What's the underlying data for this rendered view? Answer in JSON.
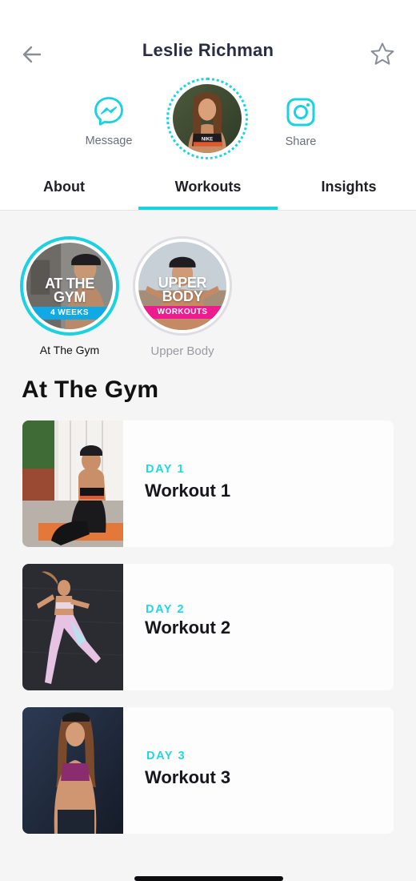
{
  "header": {
    "title": "Leslie Richman"
  },
  "actions": {
    "message_label": "Message",
    "share_label": "Share"
  },
  "tabs": [
    {
      "label": "About"
    },
    {
      "label": "Workouts"
    },
    {
      "label": "Insights"
    }
  ],
  "programs": [
    {
      "title_line1": "AT THE",
      "title_line2": "GYM",
      "badge": "4 WEEKS",
      "label": "At The Gym"
    },
    {
      "title_line1": "UPPER",
      "title_line2": "BODY",
      "badge": "WORKOUTS",
      "label": "Upper Body"
    }
  ],
  "section": {
    "title": "At The Gym"
  },
  "workouts": [
    {
      "day": "DAY 1",
      "name": "Workout 1"
    },
    {
      "day": "DAY 2",
      "name": "Workout 2"
    },
    {
      "day": "DAY 3",
      "name": "Workout 3"
    }
  ],
  "colors": {
    "accent": "#19d3e3",
    "badge_cyan": "#10a9e6",
    "badge_pink": "#ec1c8e",
    "title": "#2b2d42"
  },
  "icons": {
    "back": "back-arrow-icon",
    "favorite": "star-icon",
    "message": "messenger-icon",
    "share": "instagram-icon"
  }
}
